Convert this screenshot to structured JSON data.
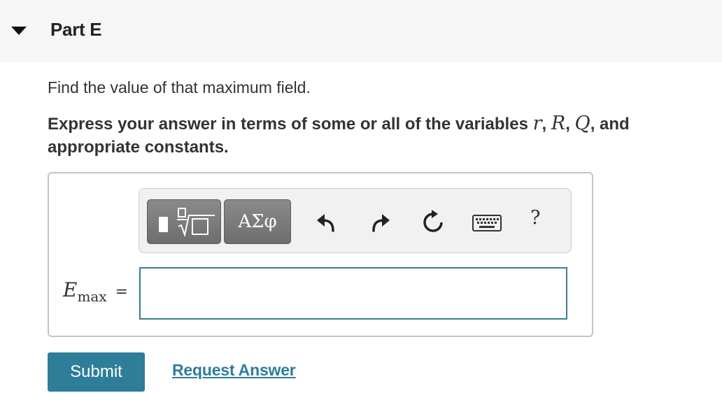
{
  "part": {
    "title": "Part E"
  },
  "question": {
    "text": "Find the value of that maximum field.",
    "instruction_prefix": "Express your answer in terms of some or all of the variables ",
    "variables": [
      "r",
      "R",
      "Q"
    ],
    "sep1": ", ",
    "sep2": ", ",
    "sep3": ", and",
    "instruction_suffix": "appropriate constants."
  },
  "toolbar": {
    "greek_label": "ΑΣφ",
    "help_label": "?",
    "icons": [
      "templates-icon",
      "greek-letters-icon",
      "undo-icon",
      "redo-icon",
      "reset-icon",
      "keyboard-icon",
      "help-icon"
    ]
  },
  "answer": {
    "symbol": "E",
    "subscript": "max",
    "equals": "=",
    "value": "",
    "input_border_color": "#3b7d95"
  },
  "actions": {
    "submit_label": "Submit",
    "request_label": "Request Answer",
    "accent_color": "#2e7d99"
  }
}
